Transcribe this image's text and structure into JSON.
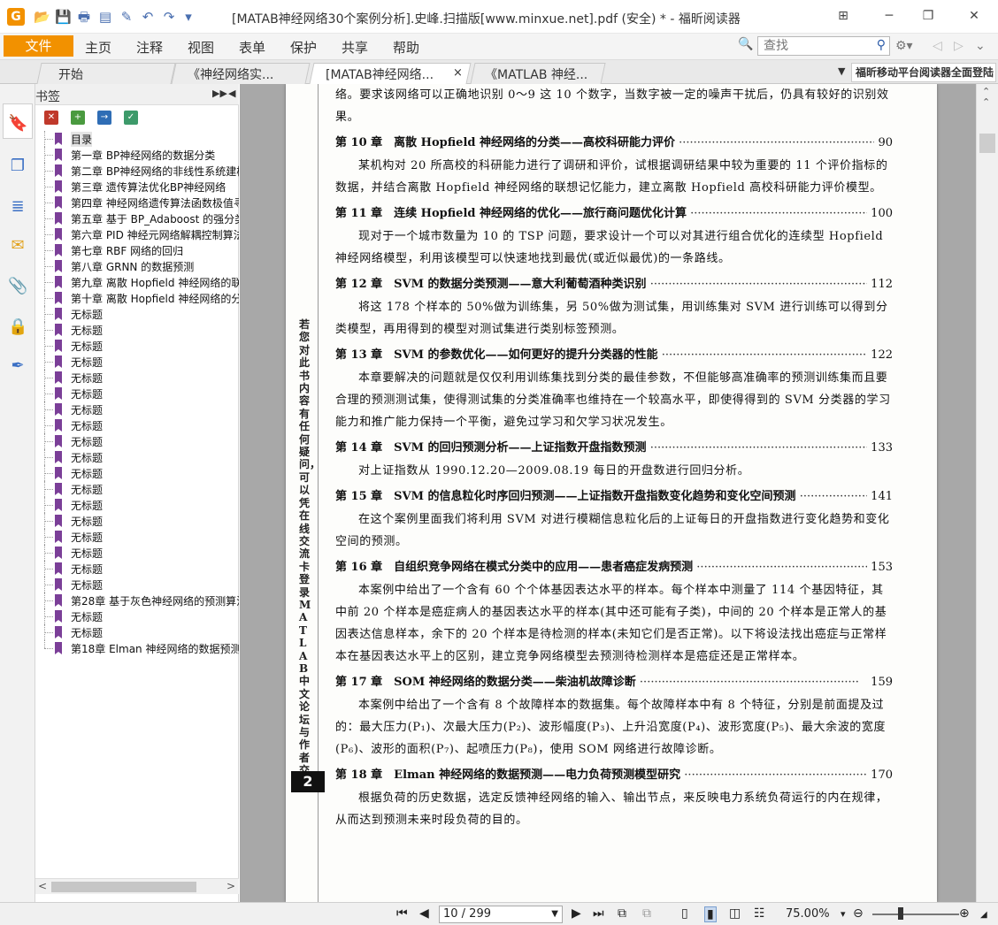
{
  "window": {
    "title": "[MATAB神经网络30个案例分析].史峰.扫描版[www.minxue.net].pdf (安全) * - 福昕阅读器",
    "logo_letter": "G"
  },
  "quick_access": [
    {
      "name": "open-icon",
      "glyph": "📂"
    },
    {
      "name": "save-icon",
      "glyph": "💾"
    },
    {
      "name": "print-icon",
      "glyph": "🖶"
    },
    {
      "name": "properties-icon",
      "glyph": "▤"
    },
    {
      "name": "new-icon",
      "glyph": "✎"
    },
    {
      "name": "undo-icon",
      "glyph": "↶"
    },
    {
      "name": "redo-icon",
      "glyph": "↷"
    },
    {
      "name": "customize-icon",
      "glyph": "▾"
    }
  ],
  "menu": {
    "file": "文件",
    "items": [
      "主页",
      "注释",
      "视图",
      "表单",
      "保护",
      "共享",
      "帮助"
    ]
  },
  "search": {
    "placeholder": "查找"
  },
  "tabs": [
    {
      "label": "开始"
    },
    {
      "label": "《神经网络实..."
    },
    {
      "label": "[MATAB神经网络...",
      "close": "×"
    },
    {
      "label": "《MATLAB 神经..."
    }
  ],
  "promo": "福昕移动平台阅读器全面登陆",
  "bookmarks": {
    "title": "书签",
    "items": [
      "目录",
      "第一章 BP神经网络的数据分类",
      "第二章 BP神经网络的非线性系统建模",
      "第三章 遗传算法优化BP神经网络",
      "第四章 神经网络遗传算法函数极值寻优",
      "第五章 基于 BP_Adaboost 的强分类器",
      "第六章 PID 神经元网络解耦控制算法",
      "第七章 RBF 网络的回归",
      "第八章 GRNN 的数据预测",
      "第九章 离散 Hopfield 神经网络的联想记忆",
      "第十章 离散 Hopfield 神经网络的分类",
      "无标题",
      "无标题",
      "无标题",
      "无标题",
      "无标题",
      "无标题",
      "无标题",
      "无标题",
      "无标题",
      "无标题",
      "无标题",
      "无标题",
      "无标题",
      "无标题",
      "无标题",
      "无标题",
      "无标题",
      "无标题",
      "第28章 基于灰色神经网络的预测算法",
      "无标题",
      "无标题",
      "第18章 Elman 神经网络的数据预测"
    ]
  },
  "document": {
    "side_note": "若您对此书内容有任何疑问，可以凭在线交流卡登录MATLAB中文论坛与作者交流。",
    "page_number_box": "2",
    "top_text": "络。要求该网络可以正确地识别 0～9 这 10 个数字，当数字被一定的噪声干扰后，仍具有较好的识别效果。",
    "entries": [
      {
        "chapter": "第 10 章",
        "title": "离散 Hopfield 神经网络的分类——高校科研能力评价",
        "page": "90",
        "desc": "某机构对 20 所高校的科研能力进行了调研和评价，试根据调研结果中较为重要的 11 个评价指标的数据，并结合离散 Hopfield 神经网络的联想记忆能力，建立离散 Hopfield 高校科研能力评价模型。"
      },
      {
        "chapter": "第 11 章",
        "title": "连续 Hopfield 神经网络的优化——旅行商问题优化计算",
        "page": "100",
        "desc": "现对于一个城市数量为 10 的 TSP 问题，要求设计一个可以对其进行组合优化的连续型 Hopfield 神经网络模型，利用该模型可以快速地找到最优(或近似最优)的一条路线。"
      },
      {
        "chapter": "第 12 章",
        "title": "SVM 的数据分类预测——意大利葡萄酒种类识别",
        "page": "112",
        "desc": "将这 178 个样本的 50%做为训练集，另 50%做为测试集，用训练集对 SVM 进行训练可以得到分类模型，再用得到的模型对测试集进行类别标签预测。"
      },
      {
        "chapter": "第 13 章",
        "title": "SVM 的参数优化——如何更好的提升分类器的性能",
        "page": "122",
        "desc": "本章要解决的问题就是仅仅利用训练集找到分类的最佳参数，不但能够高准确率的预测训练集而且要合理的预测测试集，使得测试集的分类准确率也维持在一个较高水平，即使得得到的 SVM 分类器的学习能力和推广能力保持一个平衡，避免过学习和欠学习状况发生。"
      },
      {
        "chapter": "第 14 章",
        "title": "SVM 的回归预测分析——上证指数开盘指数预测",
        "page": "133",
        "desc": "对上证指数从 1990.12.20—2009.08.19 每日的开盘数进行回归分析。"
      },
      {
        "chapter": "第 15 章",
        "title": "SVM 的信息粒化时序回归预测——上证指数开盘指数变化趋势和变化空间预测",
        "page": "141",
        "desc": "在这个案例里面我们将利用 SVM 对进行模糊信息粒化后的上证每日的开盘指数进行变化趋势和变化空间的预测。"
      },
      {
        "chapter": "第 16 章",
        "title": "自组织竞争网络在模式分类中的应用——患者癌症发病预测",
        "page": "153",
        "desc": "本案例中给出了一个含有 60 个个体基因表达水平的样本。每个样本中测量了 114 个基因特征，其中前 20 个样本是癌症病人的基因表达水平的样本(其中还可能有子类)，中间的 20 个样本是正常人的基因表达信息样本，余下的 20 个样本是待检测的样本(未知它们是否正常)。以下将设法找出癌症与正常样本在基因表达水平上的区别，建立竞争网络模型去预测待检测样本是癌症还是正常样本。"
      },
      {
        "chapter": "第 17 章",
        "title": "SOM 神经网络的数据分类——柴油机故障诊断",
        "page": "159",
        "desc": "本案例中给出了一个含有 8 个故障样本的数据集。每个故障样本中有 8 个特征，分别是前面提及过的：最大压力(P₁)、次最大压力(P₂)、波形幅度(P₃)、上升沿宽度(P₄)、波形宽度(P₅)、最大余波的宽度(P₆)、波形的面积(P₇)、起喷压力(P₈)，使用 SOM 网络进行故障诊断。"
      },
      {
        "chapter": "第 18 章",
        "title": "Elman 神经网络的数据预测——电力负荷预测模型研究",
        "page": "170",
        "desc": "根据负荷的历史数据，选定反馈神经网络的输入、输出节点，来反映电力系统负荷运行的内在规律，从而达到预测未来时段负荷的目的。"
      }
    ]
  },
  "statusbar": {
    "page_display": "10 / 299",
    "zoom": "75.00%"
  },
  "colors": {
    "accent": "#f29100",
    "bookmark_flag": "#7b3f98",
    "icon_blue": "#3a6fc4"
  }
}
